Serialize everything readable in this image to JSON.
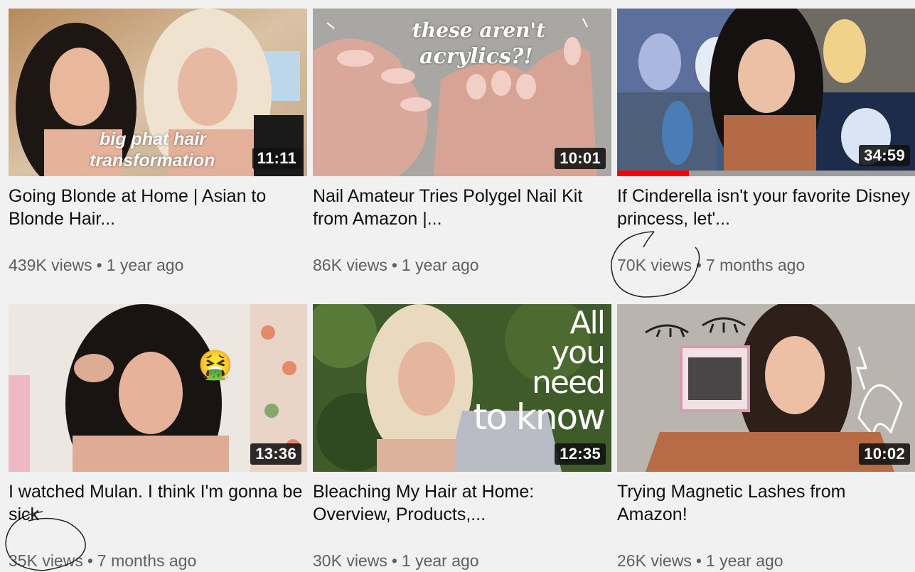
{
  "videos": [
    {
      "title": "Going Blonde at Home | Asian to Blonde Hair...",
      "duration": "11:11",
      "views": "439K views",
      "age": "1 year ago",
      "overlay": [
        "big phat hair",
        "transformation"
      ]
    },
    {
      "title": "Nail Amateur Tries Polygel Nail Kit from Amazon |...",
      "duration": "10:01",
      "views": "86K views",
      "age": "1 year ago",
      "overlay": [
        "these aren't",
        "acrylics?!"
      ]
    },
    {
      "title": "If Cinderella isn't your favorite Disney princess, let'...",
      "duration": "34:59",
      "views": "70K views",
      "age": "7 months ago",
      "watched_fraction": 0.24
    },
    {
      "title": "I watched Mulan. I think I'm gonna be sick",
      "duration": "13:36",
      "views": "35K views",
      "age": "7 months ago",
      "overlay": [
        "🤮"
      ]
    },
    {
      "title": "Bleaching My Hair at Home: Overview, Products,...",
      "duration": "12:35",
      "views": "30K views",
      "age": "1 year ago",
      "overlay": [
        "All",
        "you",
        "need",
        "to know"
      ]
    },
    {
      "title": "Trying Magnetic Lashes from Amazon!",
      "duration": "10:02",
      "views": "26K views",
      "age": "1 year ago"
    }
  ],
  "separator": "•",
  "colors": {
    "background": "#f1f1f1",
    "title": "#0f0f0f",
    "meta": "#606060",
    "progress": "#ff0000"
  }
}
